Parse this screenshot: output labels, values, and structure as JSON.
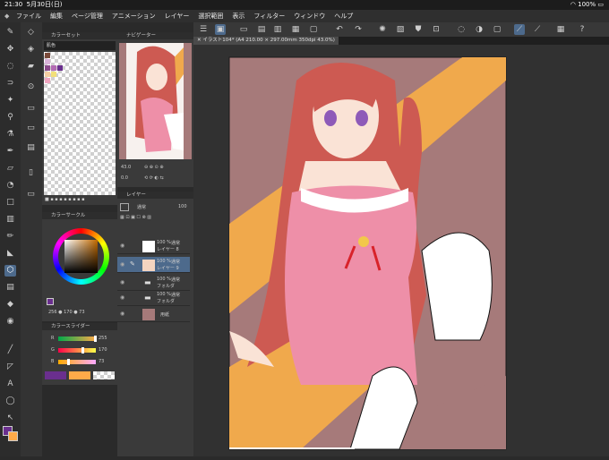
{
  "status": {
    "time": "21:30",
    "date": "5月30日(日)",
    "wifi": "wifi-icon",
    "battery": "100%"
  },
  "menu": {
    "items": [
      "ファイル",
      "編集",
      "ページ管理",
      "アニメーション",
      "レイヤー",
      "選択範囲",
      "表示",
      "フィルター",
      "ウィンドウ",
      "ヘルプ"
    ]
  },
  "document": {
    "tab": "イラスト104* (A4 210.00 × 297.00mm 350dpi 43.0%)"
  },
  "colorset": {
    "title": "カラーセット",
    "set_name": "肌色"
  },
  "navigator": {
    "title": "ナビゲーター",
    "zoom": "43.0",
    "angle": "0.0"
  },
  "layers_panel": {
    "title": "レイヤー",
    "blend_mode": "通常",
    "opacity": "100",
    "layers": [
      {
        "percent": "100 %",
        "mode": "通常",
        "name": "レイヤー 8"
      },
      {
        "percent": "100 %",
        "mode": "通常",
        "name": "レイヤー 9"
      },
      {
        "percent": "100 %",
        "mode": "通常",
        "name": "フォルダ"
      },
      {
        "percent": "100 %",
        "mode": "通常",
        "name": "フォルダ"
      },
      {
        "percent": "",
        "mode": "",
        "name": "用紙"
      }
    ]
  },
  "color_circle": {
    "title": "カラーサークル",
    "values": "256 ● 170 ● 73"
  },
  "color_slider": {
    "title": "カラースライダー",
    "r_label": "R",
    "g_label": "G",
    "b_label": "B",
    "r": "255",
    "g": "170",
    "b": "73",
    "r_level": 1.0,
    "g_level": 0.667,
    "b_level": 0.286
  },
  "colors": {
    "main": "#ffaa49",
    "sub": "#6a2f8e",
    "accent": "#4d6a8c"
  }
}
